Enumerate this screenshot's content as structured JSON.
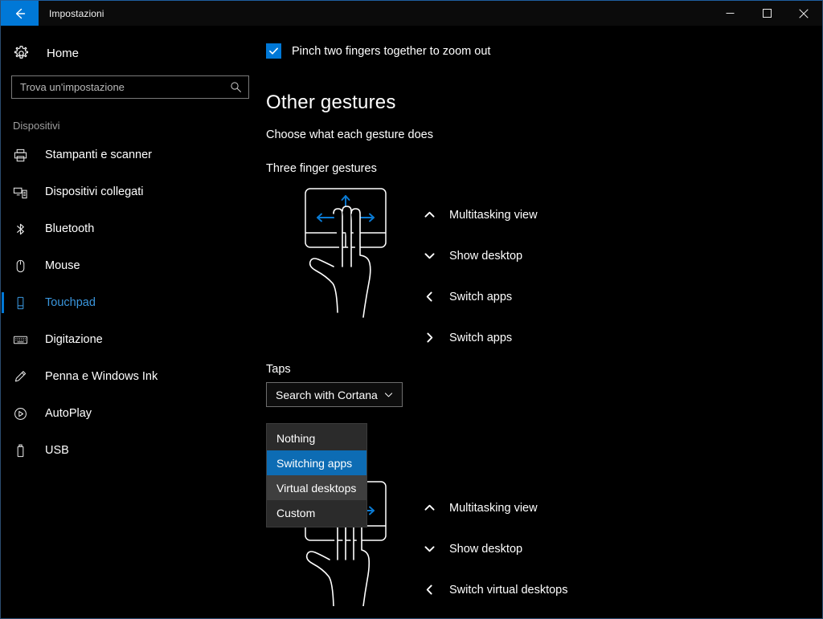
{
  "window": {
    "title": "Impostazioni",
    "back_icon": "back-arrow-icon",
    "minimize_label": "–",
    "maximize_label": "□",
    "close_label": "✕",
    "accent_color": "#0078d7",
    "background_color": "#000000"
  },
  "sidebar": {
    "home_label": "Home",
    "home_icon": "gear-icon",
    "search": {
      "placeholder": "Trova un'impostazione",
      "value": "",
      "icon": "search-icon"
    },
    "group_title": "Dispositivi",
    "items": [
      {
        "label": "Stampanti e scanner",
        "icon": "printer-icon",
        "selected": false
      },
      {
        "label": "Dispositivi collegati",
        "icon": "connected-devices-icon",
        "selected": false
      },
      {
        "label": "Bluetooth",
        "icon": "bluetooth-icon",
        "selected": false
      },
      {
        "label": "Mouse",
        "icon": "mouse-icon",
        "selected": false
      },
      {
        "label": "Touchpad",
        "icon": "touchpad-icon",
        "selected": true
      },
      {
        "label": "Digitazione",
        "icon": "keyboard-icon",
        "selected": false
      },
      {
        "label": "Penna e Windows Ink",
        "icon": "pen-icon",
        "selected": false
      },
      {
        "label": "AutoPlay",
        "icon": "autoplay-icon",
        "selected": false
      },
      {
        "label": "USB",
        "icon": "usb-icon",
        "selected": false
      }
    ]
  },
  "main": {
    "pinch_checkbox": {
      "label": "Pinch two fingers together to zoom out",
      "checked": true,
      "check_color": "#0078d7"
    },
    "heading": "Other gestures",
    "subheading": "Choose what each gesture does",
    "three_finger": {
      "section_label": "Three finger gestures",
      "illustration": "three-finger-touchpad-illustration",
      "gestures": [
        {
          "direction": "up",
          "chevron": "chevron-up-icon",
          "action": "Multitasking view"
        },
        {
          "direction": "down",
          "chevron": "chevron-down-icon",
          "action": "Show desktop"
        },
        {
          "direction": "left",
          "chevron": "chevron-left-icon",
          "action": "Switch apps"
        },
        {
          "direction": "right",
          "chevron": "chevron-right-icon",
          "action": "Switch apps"
        }
      ],
      "taps": {
        "label": "Taps",
        "selected_value": "Search with Cortana",
        "chevron": "chevron-down-icon",
        "expanded": true,
        "options": [
          {
            "label": "Nothing",
            "state": "normal"
          },
          {
            "label": "Switching apps",
            "state": "selected"
          },
          {
            "label": "Virtual desktops",
            "state": "hovered"
          },
          {
            "label": "Custom",
            "state": "normal"
          }
        ],
        "selected_option_color": "#0d6cb4",
        "hovered_option_color": "#3f3f3f"
      }
    },
    "four_finger": {
      "illustration": "four-finger-touchpad-illustration",
      "gestures": [
        {
          "direction": "up",
          "chevron": "chevron-up-icon",
          "action": "Multitasking view"
        },
        {
          "direction": "down",
          "chevron": "chevron-down-icon",
          "action": "Show desktop"
        },
        {
          "direction": "left",
          "chevron": "chevron-left-icon",
          "action": "Switch virtual desktops"
        }
      ]
    }
  }
}
